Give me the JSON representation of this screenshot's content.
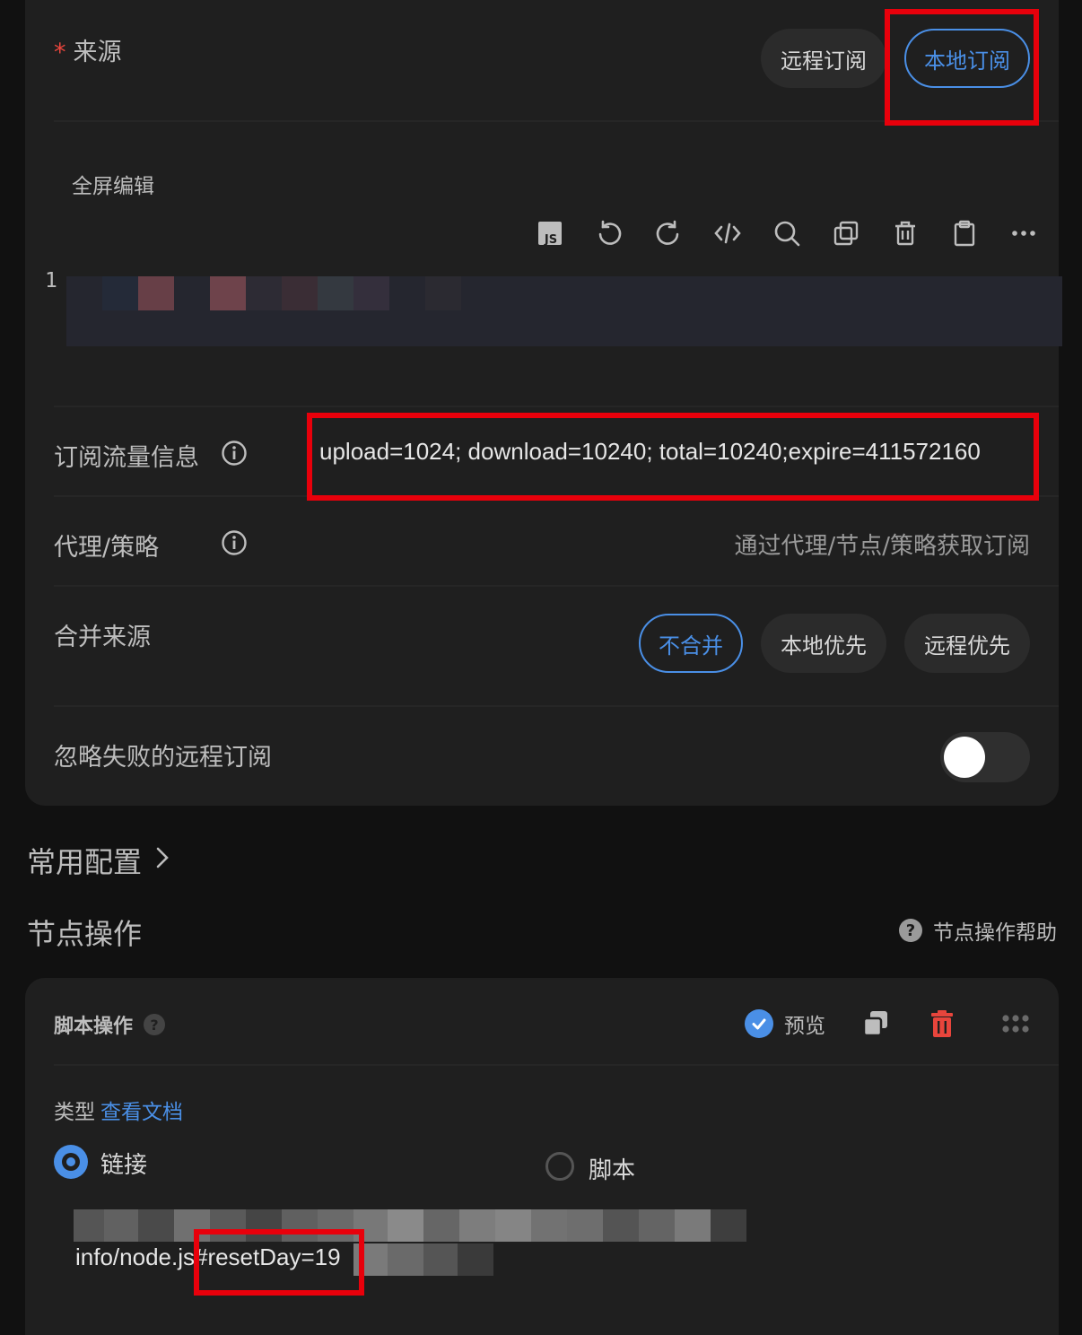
{
  "source": {
    "required_mark": "*",
    "label": "来源",
    "options": [
      "远程订阅",
      "本地订阅"
    ],
    "selected": "本地订阅"
  },
  "editor": {
    "fullscreen_label": "全屏编辑",
    "toolbar_icons": [
      "js-icon",
      "undo-icon",
      "redo-icon",
      "code-icon",
      "search-icon",
      "copy-icon",
      "trash-icon",
      "clipboard-icon",
      "more-icon"
    ],
    "line_number": "1"
  },
  "traffic": {
    "label": "订阅流量信息",
    "value": "upload=1024; download=10240; total=10240;expire=411572160"
  },
  "proxy": {
    "label": "代理/策略",
    "placeholder": "通过代理/节点/策略获取订阅"
  },
  "merge": {
    "label": "合并来源",
    "options": [
      "不合并",
      "本地优先",
      "远程优先"
    ],
    "selected": "不合并"
  },
  "ignore_failed": {
    "label": "忽略失败的远程订阅",
    "enabled": false
  },
  "common_config": {
    "title": "常用配置"
  },
  "node_ops": {
    "title": "节点操作",
    "help": "节点操作帮助",
    "help_icon_text": "?"
  },
  "script_op": {
    "title": "脚本操作",
    "q_icon_text": "?",
    "preview_label": "预览",
    "type_label": "类型",
    "doc_link": "查看文档",
    "radio_link": "链接",
    "radio_script": "脚本",
    "selected_type": "链接",
    "url_visible": "info/node.js#resetDay=19"
  },
  "colors": {
    "accent": "#4a8fe6",
    "danger": "#e8453c",
    "highlight_box": "#e8000b",
    "card_bg": "#1f1f1f",
    "page_bg": "#111111"
  }
}
